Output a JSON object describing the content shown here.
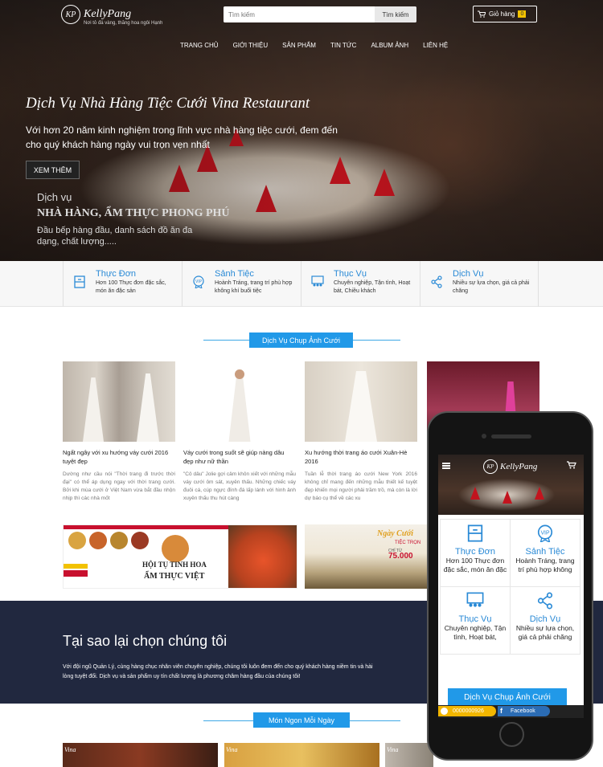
{
  "header": {
    "logo_monogram": "KP",
    "logo_name": "KellyPang",
    "logo_tagline": "Nơi tỏ đá vàng, thăng hoa ngôi Hạnh",
    "search_placeholder": "Tìm kiếm",
    "search_button": "Tìm kiếm",
    "cart_label": "Giỏ hàng",
    "cart_count": "0",
    "nav": [
      "TRANG CHỦ",
      "GIỚI THIỆU",
      "SẢN PHẨM",
      "TIN TỨC",
      "ALBUM ẢNH",
      "LIÊN HỆ"
    ]
  },
  "hero": {
    "title": "Dịch Vụ Nhà Hàng Tiệc Cưới Vina Restaurant",
    "description": "Với hơn 20 năm kinh nghiệm trong lĩnh vực nhà hàng tiệc cưới, đem đến cho quý khách hàng ngày vui trọn vẹn nhất",
    "button": "XEM THÊM",
    "sub_label": "Dịch vụ",
    "sub_heading": "NHÀ HÀNG, ẨM THỰC PHONG PHÚ",
    "sub_desc": "Đầu bếp hàng đầu, danh sách đồ ăn đa dạng, chất lượng....."
  },
  "features": [
    {
      "icon": "menu-board-icon",
      "title": "Thực Đơn",
      "desc": "Hơn 100 Thực đơn đặc sắc, món ăn đặc sản"
    },
    {
      "icon": "vip-badge-icon",
      "title": "Sảnh Tiệc",
      "desc": "Hoành Tráng, trang trí phù hợp không khí buổi tiệc"
    },
    {
      "icon": "presentation-icon",
      "title": "Thục Vụ",
      "desc": "Chuyên nghiệp, Tận tình, Hoạt bát, Chiều khách"
    },
    {
      "icon": "share-icon",
      "title": "Dịch Vụ",
      "desc": "Nhiều sự lựa chọn, giá cả phải chăng"
    }
  ],
  "section_photo": {
    "title": "Dịch Vụ Chụp Ảnh Cưới",
    "cards": [
      {
        "title": "Ngất ngây với xu hướng váy cưới 2016 tuyệt đẹp",
        "desc": "Dường như cầu nói \"Thời trang đi trước thời đại\" có thể áp dụng ngay với thời trang cưới. Bởi khi mùa cưới ở Việt Nam vừa bắt đầu nhộn nhịp thì các nhà mốt"
      },
      {
        "title": "Váy cưới trong suốt sẽ giúp nàng dâu đẹp như nữ thần",
        "desc": "\"Cô dâu\" Jolie gợi cảm khôn xiết với những mẫu váy cưới ôm sát, xuyên thấu. Những chiếc váy đuôi cá, cúp ngực đính đá lấp lánh với hình ảnh xuyên thấu thu hút càng"
      },
      {
        "title": "Xu hướng thời trang áo cưới Xuân-Hè 2016",
        "desc": "Tuần lễ thời trang áo cưới New York 2016 không chỉ mang đến những mẫu thiết kế tuyệt đẹp khiến mọi người phải trầm trồ, mà còn là lời dự báo cụ thể về các xu"
      }
    ]
  },
  "banners": {
    "left_text_1": "HỘI TỤ TINH HOA",
    "left_text_2": "ẨM THỰC VIỆT",
    "right_title": "Ngày Cưới",
    "right_line": "TIỆC TRỌN",
    "right_price_prefix": "CHỈ TỪ",
    "right_price": "75.000"
  },
  "why": {
    "title": "Tại sao lại chọn chúng tôi",
    "desc": "Với đội ngũ Quản Lý, cùng hàng chục nhân viên chuyên nghiệp, chúng tôi luôn đem đến cho quý khách hàng niềm tin và hài lòng tuyệt đối. Dịch vụ và sản phẩm uy tín chất lượng là phương châm hàng đầu của chúng tôi!"
  },
  "section_food": {
    "title": "Món Ngon Mỗi Ngày",
    "logo_text": "Vina"
  },
  "mobile": {
    "logo_name": "KellyPang",
    "logo_monogram": "KP",
    "features": [
      {
        "title": "Thực Đơn",
        "desc": "Hơn 100 Thực đơn đặc sắc, món ăn đặc"
      },
      {
        "title": "Sảnh Tiệc",
        "desc": "Hoành Tráng, trang trí phù hợp không"
      },
      {
        "title": "Thục Vụ",
        "desc": "Chuyên nghiệp, Tận tình, Hoạt bát,"
      },
      {
        "title": "Dịch Vụ",
        "desc": "Nhiều sự lựa chọn, giá cả phải chăng"
      }
    ],
    "section_title": "Dịch Vụ Chụp Ảnh Cưới",
    "phone": "0000000926",
    "facebook": "Facebook"
  },
  "colors": {
    "accent": "#2199e8",
    "dark_band": "#21283f",
    "cart_badge": "#f2c200"
  }
}
